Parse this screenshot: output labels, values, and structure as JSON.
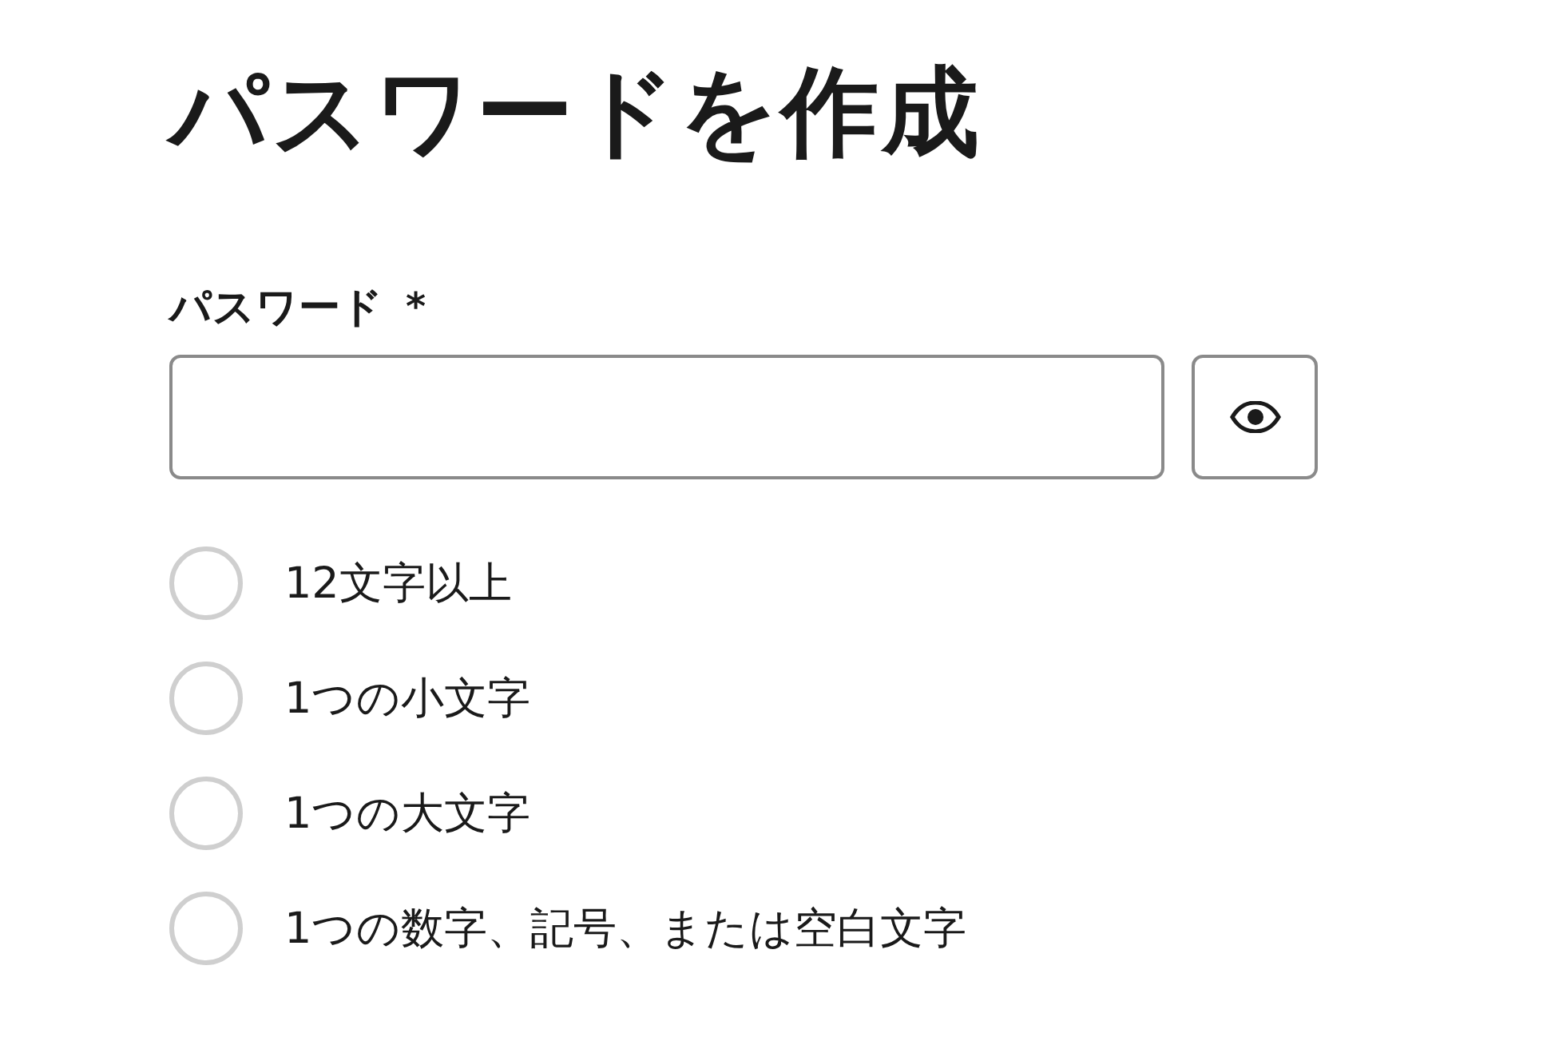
{
  "title": "パスワードを作成",
  "password_field": {
    "label": "パスワード",
    "required_mark": "*",
    "reveal_button": {
      "visible": false
    }
  },
  "requirements": [
    {
      "text": "12文字以上",
      "met": false
    },
    {
      "text": "1つの小文字",
      "met": false
    },
    {
      "text": "1つの大文字",
      "met": false
    },
    {
      "text": "1つの数字、記号、または空白文字",
      "met": false
    }
  ]
}
